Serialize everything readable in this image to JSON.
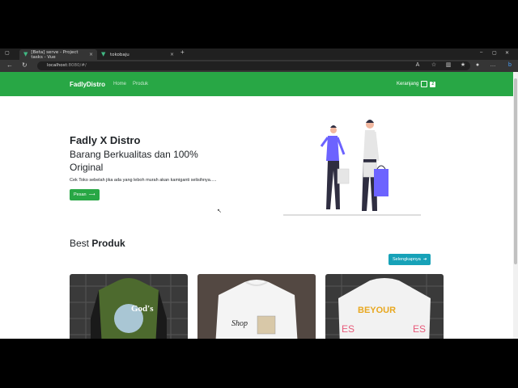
{
  "browser": {
    "tabs": [
      {
        "label": "[Beta] serve - Project tasks - Vue",
        "active": true
      },
      {
        "label": "tokobaju",
        "active": false
      }
    ],
    "url_host": "localhost",
    "url_rest": ":8080/#/"
  },
  "navbar": {
    "brand": "FadlyDistro",
    "links": [
      "Home",
      "Produk"
    ],
    "cart_label": "Keranjang",
    "cart_count": "2"
  },
  "hero": {
    "title": "Fadly X Distro",
    "subtitle": "Barang Berkualitas dan 100% Original",
    "description": "Cek Toko sebelah jika ada yang leboh murah akan kamiganti selisihnya.....",
    "button_label": "Pesan"
  },
  "best": {
    "title_prefix": "Best",
    "title_bold": "Produk",
    "more_label": "Selengkapnya"
  },
  "products": [
    {
      "shirt": "green-black",
      "print": "God's"
    },
    {
      "shirt": "white",
      "print": "Shop"
    },
    {
      "shirt": "white",
      "print": "BEYOUR"
    }
  ],
  "colors": {
    "brand_green": "#28a745",
    "info": "#17a2b8",
    "purple": "#6c63ff"
  }
}
